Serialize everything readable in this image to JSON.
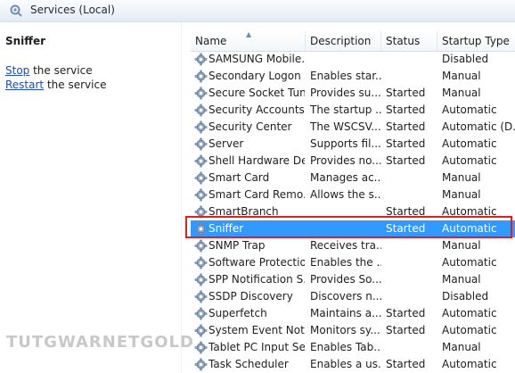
{
  "window": {
    "title": "Services (Local)"
  },
  "left_pane": {
    "service_name": "Sniffer",
    "actions": [
      {
        "link": "Stop",
        "rest": " the service"
      },
      {
        "link": "Restart",
        "rest": " the service"
      }
    ]
  },
  "table": {
    "columns": [
      "Name",
      "Description",
      "Status",
      "Startup Type"
    ],
    "sorted_column": "Name",
    "rows": [
      {
        "name": "SAMSUNG Mobile...",
        "description": "",
        "status": "",
        "startup": "Disabled"
      },
      {
        "name": "Secondary Logon",
        "description": "Enables star...",
        "status": "",
        "startup": "Manual"
      },
      {
        "name": "Secure Socket Tun...",
        "description": "Provides su...",
        "status": "Started",
        "startup": "Manual"
      },
      {
        "name": "Security Accounts...",
        "description": "The startup ...",
        "status": "Started",
        "startup": "Automatic"
      },
      {
        "name": "Security Center",
        "description": "The WSCSV...",
        "status": "Started",
        "startup": "Automatic (D..."
      },
      {
        "name": "Server",
        "description": "Supports fil...",
        "status": "Started",
        "startup": "Automatic"
      },
      {
        "name": "Shell Hardware De...",
        "description": "Provides no...",
        "status": "Started",
        "startup": "Automatic"
      },
      {
        "name": "Smart Card",
        "description": "Manages ac...",
        "status": "",
        "startup": "Manual"
      },
      {
        "name": "Smart Card Remo...",
        "description": "Allows the s...",
        "status": "",
        "startup": "Manual"
      },
      {
        "name": "SmartBranch",
        "description": "",
        "status": "Started",
        "startup": "Automatic"
      },
      {
        "name": "Sniffer",
        "description": "",
        "status": "Started",
        "startup": "Automatic",
        "selected": true
      },
      {
        "name": "SNMP Trap",
        "description": "Receives tra...",
        "status": "",
        "startup": "Manual"
      },
      {
        "name": "Software Protection",
        "description": "Enables the ...",
        "status": "",
        "startup": "Automatic"
      },
      {
        "name": "SPP Notification S...",
        "description": "Provides So...",
        "status": "",
        "startup": "Manual"
      },
      {
        "name": "SSDP Discovery",
        "description": "Discovers n...",
        "status": "",
        "startup": "Disabled"
      },
      {
        "name": "Superfetch",
        "description": "Maintains a...",
        "status": "Started",
        "startup": "Automatic"
      },
      {
        "name": "System Event Noti...",
        "description": "Monitors sy...",
        "status": "Started",
        "startup": "Automatic"
      },
      {
        "name": "Tablet PC Input Se...",
        "description": "Enables Tab...",
        "status": "",
        "startup": "Manual"
      },
      {
        "name": "Task Scheduler",
        "description": "Enables a us...",
        "status": "Started",
        "startup": "Automatic"
      }
    ]
  },
  "colors": {
    "selection": "#3399ff",
    "highlight_box": "#e11f1f",
    "link": "#1c4ea5"
  },
  "watermark": "TUTGWARNETGOLD",
  "icons": {
    "title": "services-gear-icon",
    "row": "service-gear-icon"
  }
}
